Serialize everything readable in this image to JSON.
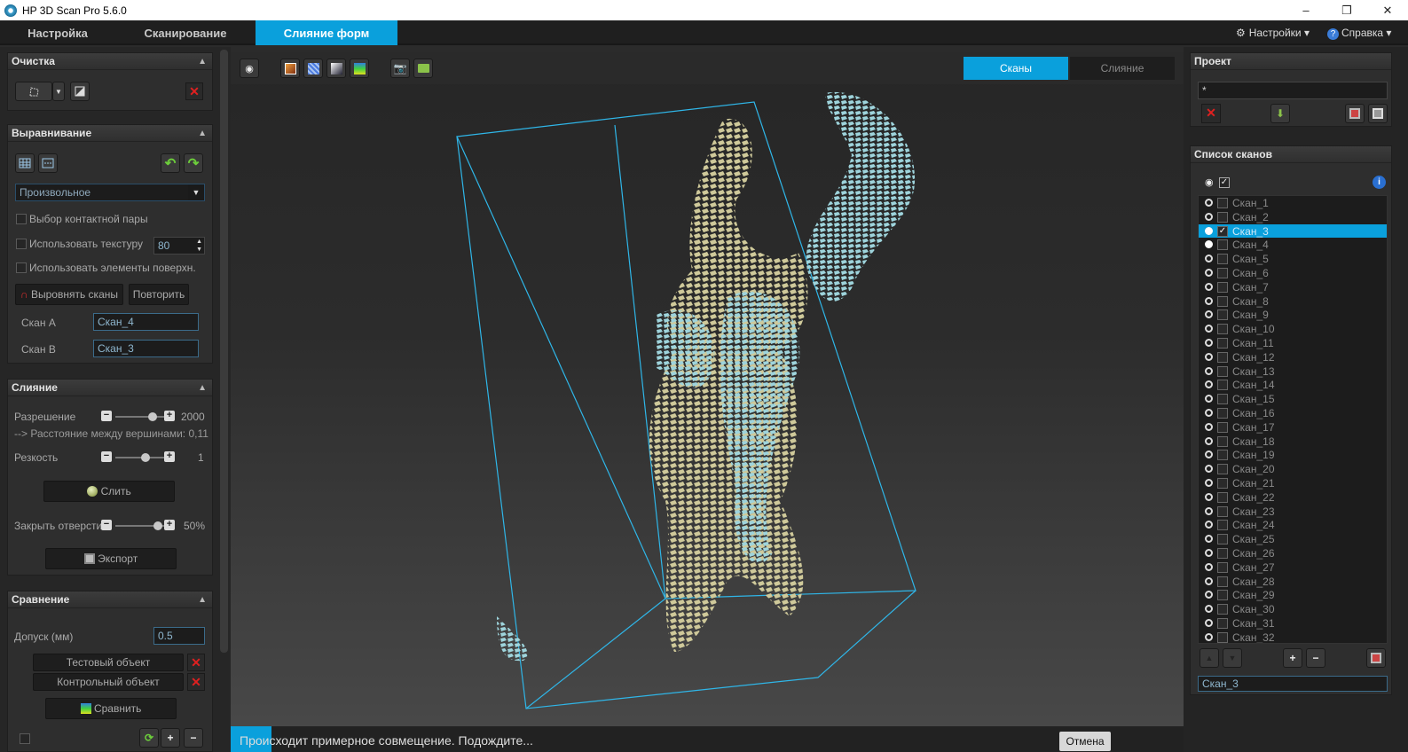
{
  "window": {
    "title": "HP 3D Scan Pro 5.6.0",
    "minimize": "–",
    "maximize": "❐",
    "close": "✕"
  },
  "menu": {
    "tabs": [
      "Настройка",
      "Сканирование",
      "Слияние форм"
    ],
    "active": 2,
    "settings": "Настройки ▾",
    "help": "Справка ▾"
  },
  "cleanup": {
    "title": "Очистка"
  },
  "alignment": {
    "title": "Выравнивание",
    "mode": "Произвольное",
    "contact_pair": "Выбор контактной пары",
    "use_texture": "Использовать текстуру",
    "texture_value": "80",
    "use_surface": "Использовать элементы поверхн.",
    "align_button": "Выровнять сканы",
    "repeat_button": "Повторить",
    "scan_a_label": "Скан А",
    "scan_a_value": "Скан_4",
    "scan_b_label": "Скан В",
    "scan_b_value": "Скан_3"
  },
  "fusion": {
    "title": "Слияние",
    "resolution_label": "Разрешение",
    "resolution_value": "2000",
    "resolution_fraction": 0.75,
    "vertex_distance": "--> Расстояние между вершинами: 0,11",
    "sharpness_label": "Резкость",
    "sharpness_value": "1",
    "sharpness_fraction": 0.6,
    "merge_button": "Слить",
    "close_holes_label": "Закрыть отверсти",
    "close_holes_value": "50%",
    "close_holes_fraction": 0.85,
    "export_button": "Экспорт"
  },
  "comparison": {
    "title": "Сравнение",
    "tolerance_label": "Допуск (мм)",
    "tolerance_value": "0.5",
    "test_object": "Тестовый объект",
    "control_object": "Контрольный объект",
    "compare_button": "Сравнить"
  },
  "viewport": {
    "tab_scans": "Сканы",
    "tab_merge": "Слияние",
    "status": "Происходит примерное совмещение. Подождите...",
    "cancel": "Отмена"
  },
  "project": {
    "title": "Проект",
    "name": "*"
  },
  "scan_list": {
    "title": "Список сканов",
    "selected_index": 2,
    "items": [
      "Скан_1",
      "Скан_2",
      "Скан_3",
      "Скан_4",
      "Скан_5",
      "Скан_6",
      "Скан_7",
      "Скан_8",
      "Скан_9",
      "Скан_10",
      "Скан_11",
      "Скан_12",
      "Скан_13",
      "Скан_14",
      "Скан_15",
      "Скан_16",
      "Скан_17",
      "Скан_18",
      "Скан_19",
      "Скан_20",
      "Скан_21",
      "Скан_22",
      "Скан_23",
      "Скан_24",
      "Скан_25",
      "Скан_26",
      "Скан_27",
      "Скан_28",
      "Скан_29",
      "Скан_30",
      "Скан_31",
      "Скан_32"
    ],
    "current": "Скан_3"
  },
  "colors": {
    "accent": "#0aa0dc",
    "scan_beige": "#cfc99a",
    "scan_cyan": "#9ed4dc"
  }
}
